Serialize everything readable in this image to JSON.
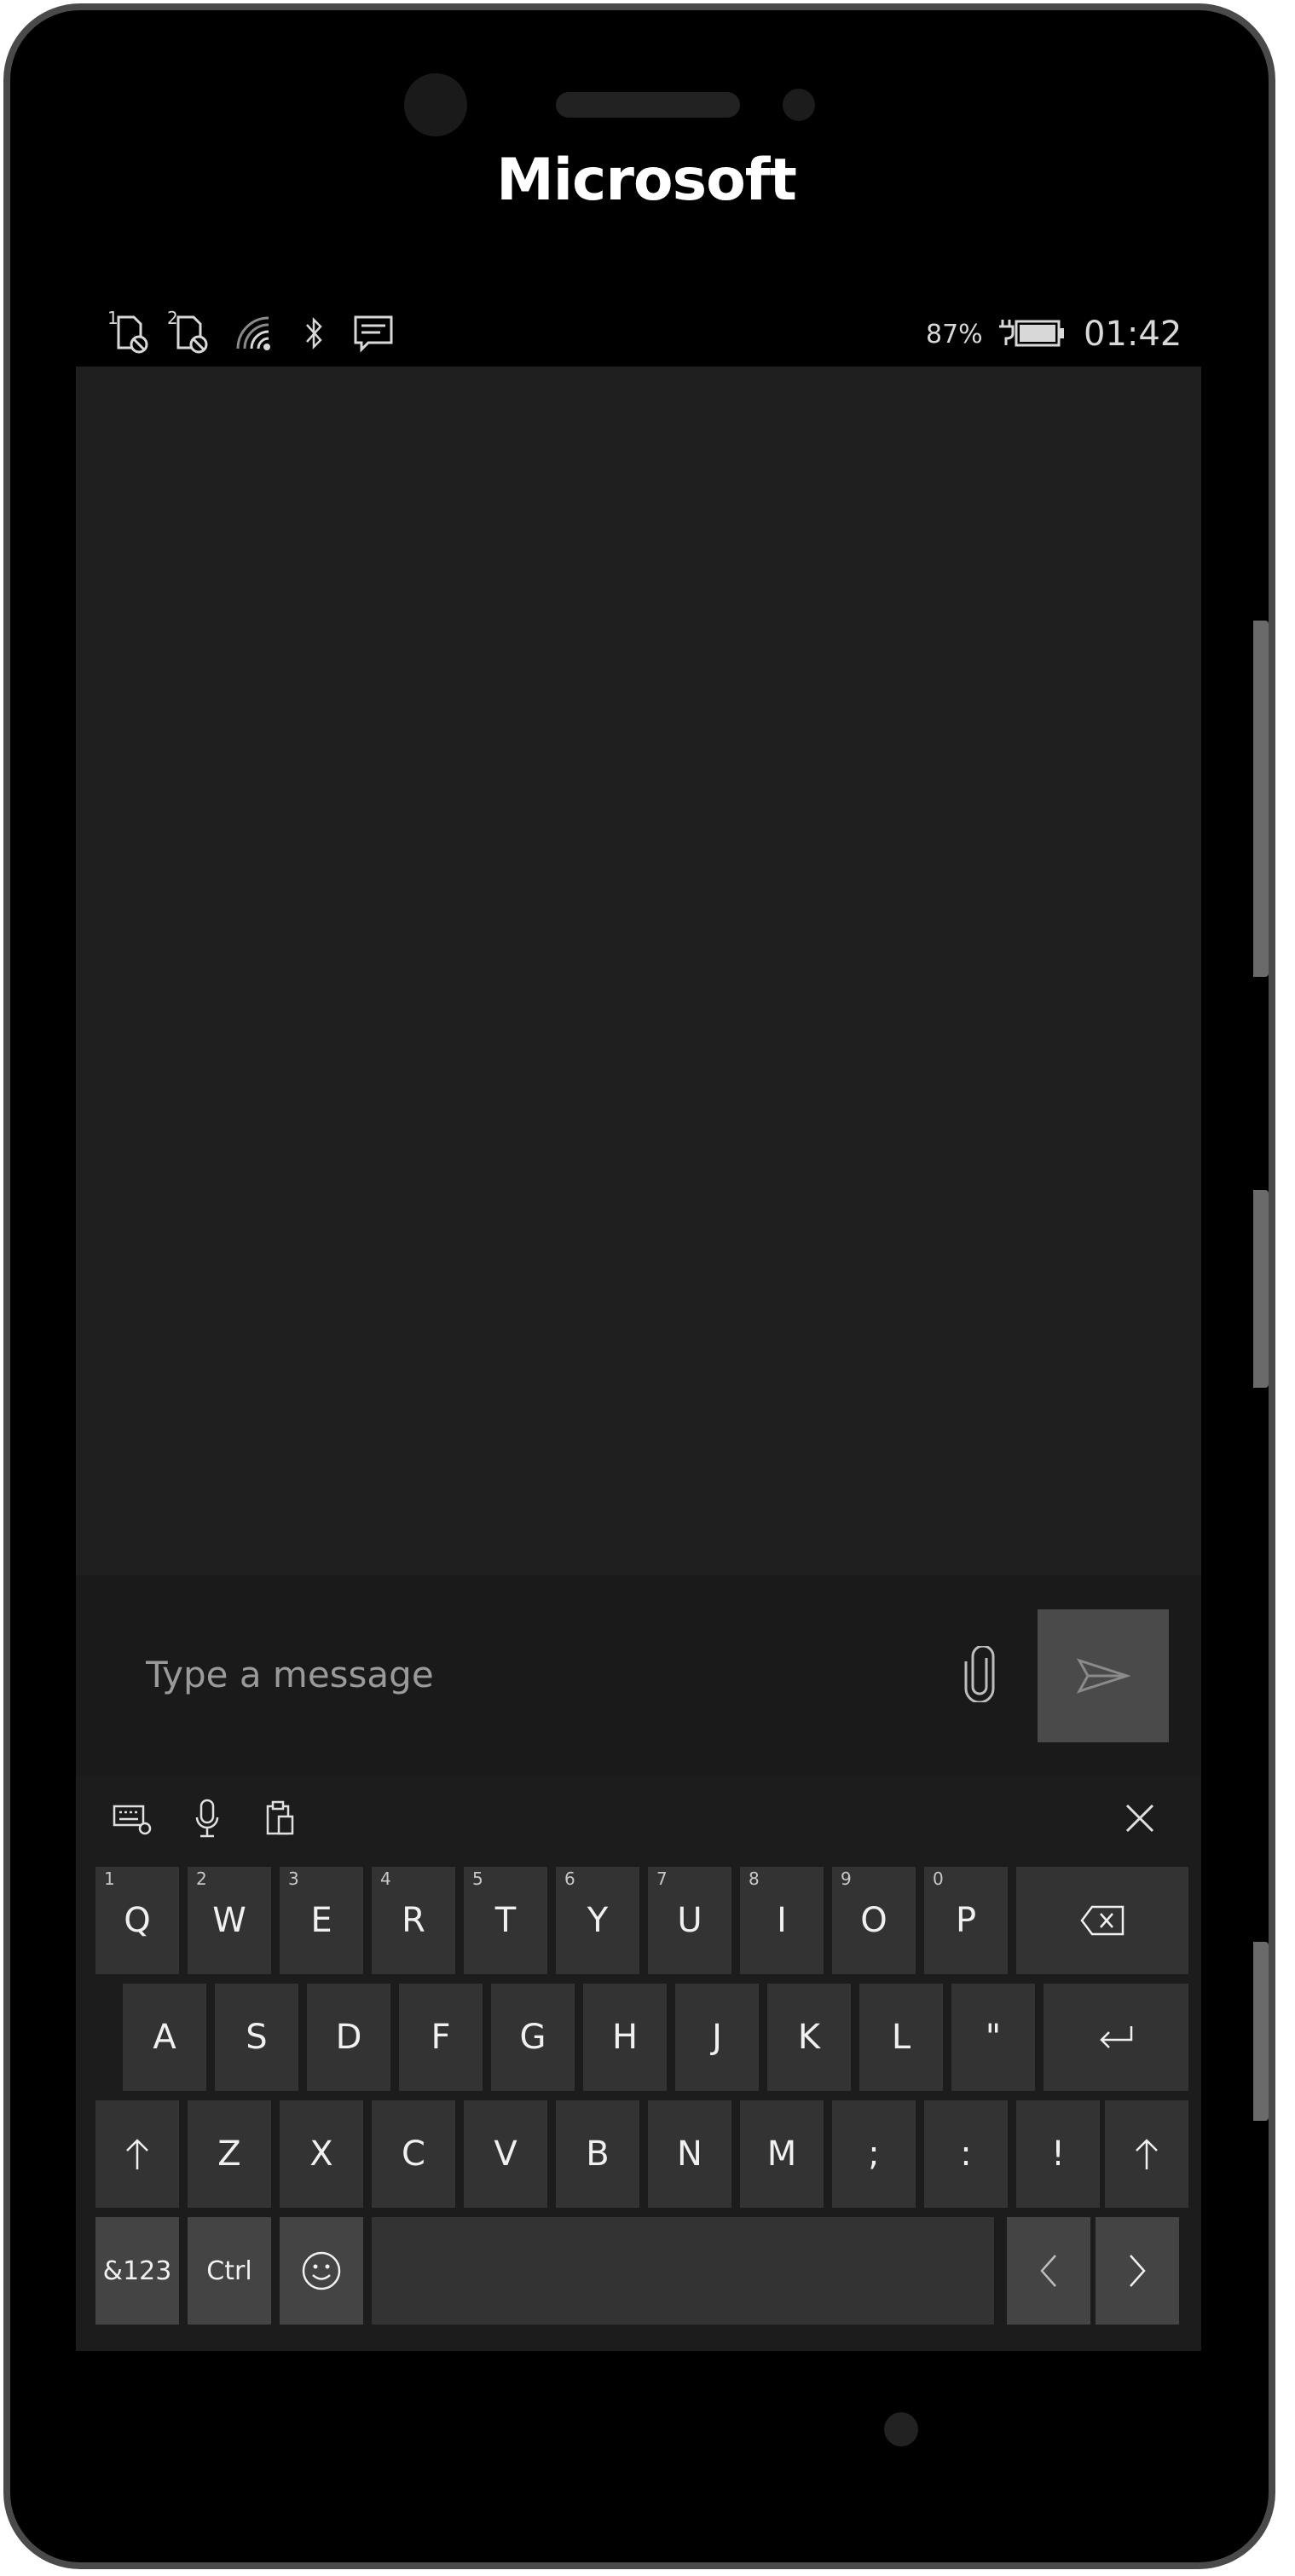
{
  "device": {
    "brand": "Microsoft"
  },
  "status_bar": {
    "sim1_label": "1",
    "sim2_label": "2",
    "battery_percent": "87%",
    "time": "01:42",
    "icons": [
      "sim1-no-service-icon",
      "sim2-no-service-icon",
      "wifi-icon",
      "bluetooth-icon",
      "notification-icon",
      "battery-charging-icon"
    ]
  },
  "compose": {
    "placeholder": "Type a message",
    "attach_icon": "paperclip-icon",
    "send_icon": "send-icon"
  },
  "keyboard": {
    "toolbar": {
      "icons": [
        "keyboard-settings-icon",
        "microphone-icon",
        "clipboard-icon",
        "close-icon"
      ]
    },
    "row1": [
      {
        "label": "Q",
        "hint": "1"
      },
      {
        "label": "W",
        "hint": "2"
      },
      {
        "label": "E",
        "hint": "3"
      },
      {
        "label": "R",
        "hint": "4"
      },
      {
        "label": "T",
        "hint": "5"
      },
      {
        "label": "Y",
        "hint": "6"
      },
      {
        "label": "U",
        "hint": "7"
      },
      {
        "label": "I",
        "hint": "8"
      },
      {
        "label": "O",
        "hint": "9"
      },
      {
        "label": "P",
        "hint": "0"
      }
    ],
    "row2": [
      "A",
      "S",
      "D",
      "F",
      "G",
      "H",
      "J",
      "K",
      "L",
      "\""
    ],
    "row3": [
      "Z",
      "X",
      "C",
      "V",
      "B",
      "N",
      "M",
      ";",
      ":",
      "!"
    ],
    "row4": {
      "symbols": "&123",
      "ctrl": "Ctrl"
    }
  },
  "colors": {
    "screen_bg": "#1f1f1f",
    "key_bg": "#333333",
    "send_bg": "#4a4a4a",
    "bezel": "#000000"
  }
}
